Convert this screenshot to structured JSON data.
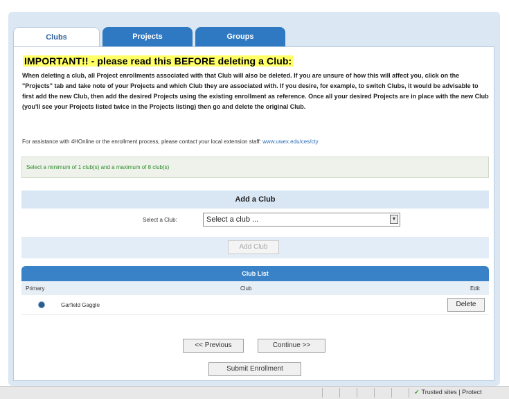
{
  "tabs": [
    {
      "label": "Clubs"
    },
    {
      "label": "Projects"
    },
    {
      "label": "Groups"
    }
  ],
  "important_title": "IMPORTANT!! - please read this BEFORE deleting a Club:",
  "warning_text": "When deleting a club, all Project enrollments associated with that Club will also be deleted. If you are unsure of how this will affect you, click on the \"Projects\" tab and take note of your Projects and which Club they are associated with. If you desire, for example, to switch Clubs, it would be advisable to first add the new Club, then add the desired Projects using the existing enrollment as reference. Once all your desired Projects are in place with the new Club (you'll see your Projects listed twice in the Projects listing) then go and delete the original Club.",
  "assistance": {
    "text": "For assistance with 4HOnline or the enrollment process, please contact your local extension staff:",
    "link": "www.uwex.edu/ces/cty"
  },
  "selection_rule": "Select a minimum of 1 club(s) and a maximum of 8 club(s)",
  "add_club": {
    "header": "Add a Club",
    "select_label": "Select a Club:",
    "select_value": "Select a club ...",
    "button_label": "Add Club"
  },
  "club_list": {
    "header": "Club List",
    "columns": {
      "primary": "Primary",
      "club": "Club",
      "edit": "Edit"
    },
    "rows": [
      {
        "club": "Garfield Gaggle",
        "delete_label": "Delete"
      }
    ]
  },
  "nav": {
    "previous": "<< Previous",
    "continue": "Continue >>",
    "submit": "Submit Enrollment"
  },
  "status_bar": {
    "zone": "Trusted sites | Protect"
  }
}
